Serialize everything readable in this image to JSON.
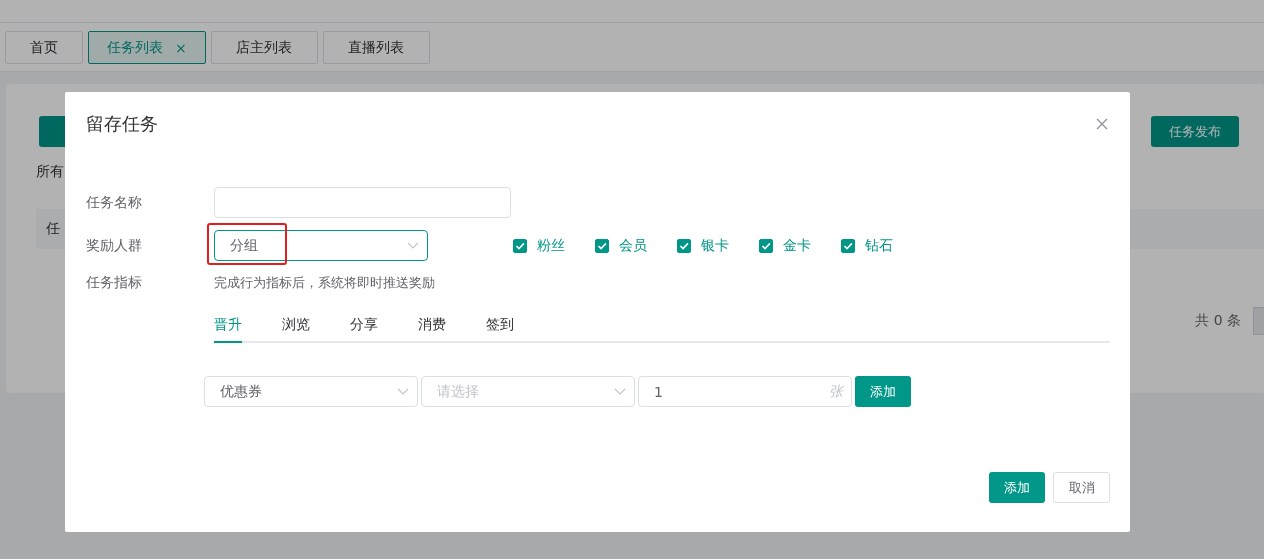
{
  "tabs": [
    {
      "label": "首页",
      "selected": false,
      "closable": false
    },
    {
      "label": "任务列表",
      "selected": true,
      "closable": true,
      "close": "×"
    },
    {
      "label": "店主列表",
      "selected": false,
      "closable": false
    },
    {
      "label": "直播列表",
      "selected": false,
      "closable": false
    }
  ],
  "page": {
    "filter_label": "所有",
    "publish_button": "任务发布",
    "table_header": "任",
    "total": "共 0 条"
  },
  "dialog": {
    "title": "留存任务",
    "fields": [
      {
        "label": "任务名称",
        "kind": "input"
      },
      {
        "label": "奖励人群",
        "kind": "select",
        "value": "分组",
        "highlighted": true
      },
      {
        "label": "任务指标",
        "kind": "text",
        "text": "完成行为指标后，系统将即时推送奖励"
      }
    ],
    "groups": [
      {
        "label": "粉丝",
        "checked": true
      },
      {
        "label": "会员",
        "checked": true
      },
      {
        "label": "银卡",
        "checked": true
      },
      {
        "label": "金卡",
        "checked": true
      },
      {
        "label": "钻石",
        "checked": true
      }
    ],
    "metric_tabs": [
      {
        "label": "晋升",
        "selected": true
      },
      {
        "label": "浏览",
        "selected": false
      },
      {
        "label": "分享",
        "selected": false
      },
      {
        "label": "消费",
        "selected": false
      },
      {
        "label": "签到",
        "selected": false
      }
    ],
    "reward_row": {
      "type_select": {
        "value": "优惠券"
      },
      "item_select": {
        "placeholder": "请选择"
      },
      "quantity": {
        "value": "1",
        "suffix": "张"
      },
      "add_button": "添加"
    },
    "buttons": [
      {
        "label": "添加",
        "kind": "primary"
      },
      {
        "label": "取消",
        "kind": "default"
      }
    ]
  }
}
